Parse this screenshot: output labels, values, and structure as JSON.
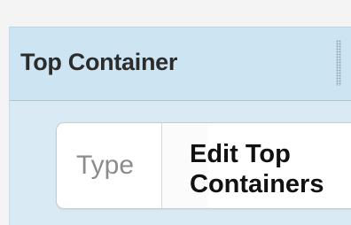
{
  "panel": {
    "title": "Top Container"
  },
  "widget": {
    "type_placeholder": "Type",
    "edit_link_line1": "Edit Top",
    "edit_link_line2": "Containers"
  },
  "icons": {
    "drag_handle": "drag-handle-icon"
  },
  "colors": {
    "panel_background": "#daeaf4",
    "header_background": "#cde4f2"
  }
}
